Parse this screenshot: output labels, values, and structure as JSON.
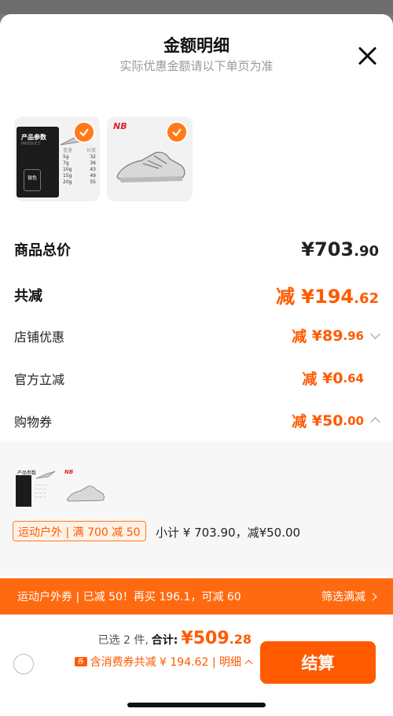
{
  "header": {
    "title": "金额明细",
    "subtitle": "实际优惠金额请以下单页为准"
  },
  "products": [
    {
      "name": "product-params-card",
      "card_label": "产品参数",
      "card_sub": "PRODUCT",
      "chip_label": "银色",
      "spec_headers": [
        "重量",
        "长度"
      ],
      "spec_rows": [
        [
          "5g",
          "32"
        ],
        [
          "7g",
          "36"
        ],
        [
          "10g",
          "43"
        ],
        [
          "15g",
          "49"
        ],
        [
          "20g",
          "55"
        ]
      ],
      "checked": true
    },
    {
      "name": "sneaker",
      "brand": "NB",
      "checked": true
    }
  ],
  "summary": {
    "total_label": "商品总价",
    "total_currency": "¥",
    "total_int": "703",
    "total_dec": ".90",
    "discount_label": "共减",
    "discount_prefix": "减",
    "discount_currency": "¥",
    "discount_int": "194",
    "discount_dec": ".62",
    "items": [
      {
        "label": "店铺优惠",
        "prefix": "减",
        "currency": "¥",
        "int": "89",
        "dec": ".96",
        "chevron": "down"
      },
      {
        "label": "官方立减",
        "prefix": "减",
        "currency": "¥",
        "int": "0",
        "dec": ".64",
        "chevron": "none"
      },
      {
        "label": "购物券",
        "prefix": "减",
        "currency": "¥",
        "int": "50",
        "dec": ".00",
        "chevron": "up"
      }
    ]
  },
  "coupon_panel": {
    "mini_card_label": "产品参数",
    "mini_brand": "NB",
    "tag": "运动户外 | 满 700 减 50",
    "subtotal": "小计 ¥ 703.90，减¥50.00"
  },
  "banner": {
    "left": "运动户外券 | 已减 50！再买 196.1，可减 60",
    "right": "筛选满减"
  },
  "footer": {
    "selected": "已选 2 件,",
    "total_label": "合计:",
    "currency": "¥",
    "amount_int": "509",
    "amount_dec": ".28",
    "ticket_icon": "券",
    "detail": "含消费券共减 ¥ 194.62 | 明细",
    "checkout": "结算"
  },
  "colors": {
    "accent": "#ff5a00",
    "banner": "#ff6a10"
  }
}
